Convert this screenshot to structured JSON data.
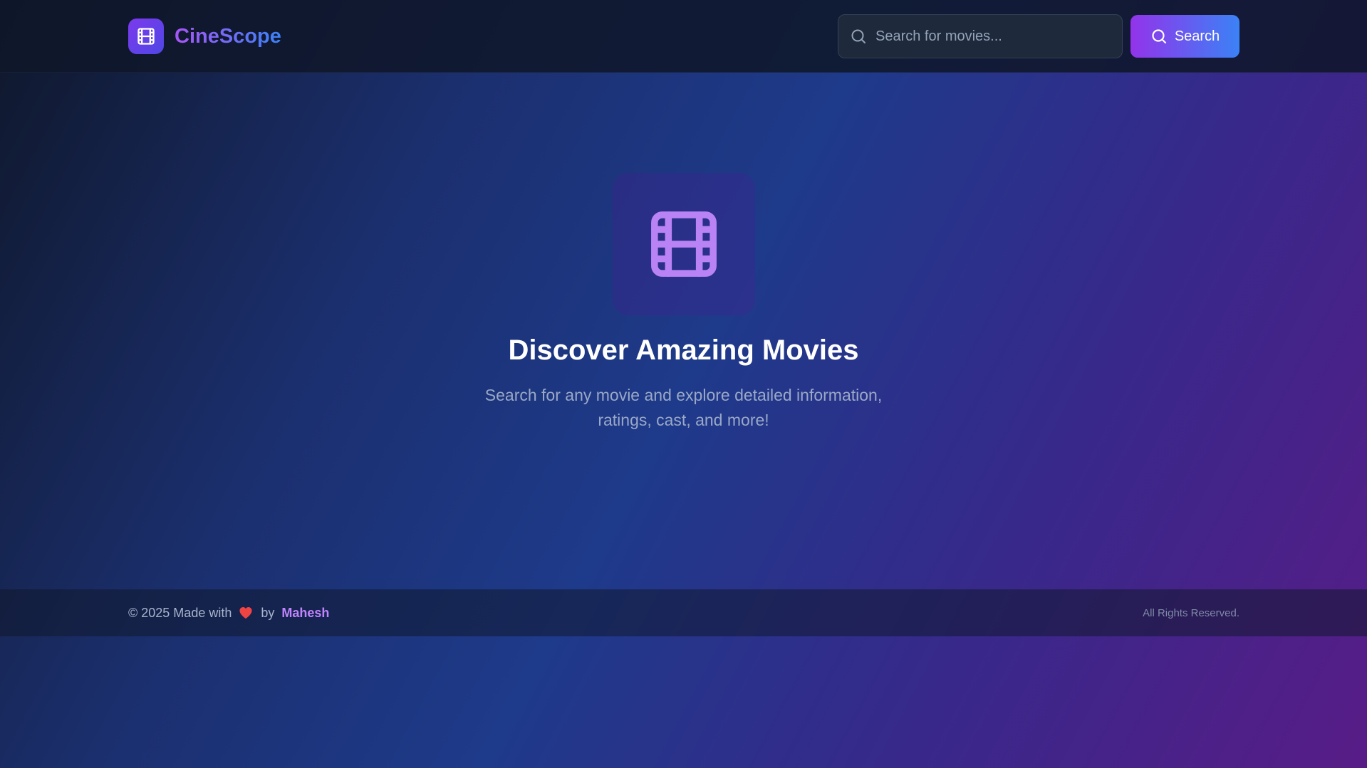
{
  "header": {
    "brand_name": "CineScope",
    "logo_icon": "film-icon",
    "search": {
      "placeholder": "Search for movies...",
      "value": "",
      "icon": "search-icon"
    },
    "search_button_label": "Search"
  },
  "hero": {
    "icon": "film-icon",
    "title": "Discover Amazing Movies",
    "subtitle": "Search for any movie and explore detailed information, ratings, cast, and more!"
  },
  "footer": {
    "copyright": "© 2025 Made with",
    "heart_icon": "heart-icon",
    "by": "by",
    "author": "Mahesh",
    "rights": "All Rights Reserved."
  },
  "colors": {
    "brand_gradient_start": "#a855f7",
    "brand_gradient_end": "#3b82f6",
    "hero_icon": "#b983f5",
    "heart": "#ef4444",
    "author_link": "#c084fc"
  }
}
